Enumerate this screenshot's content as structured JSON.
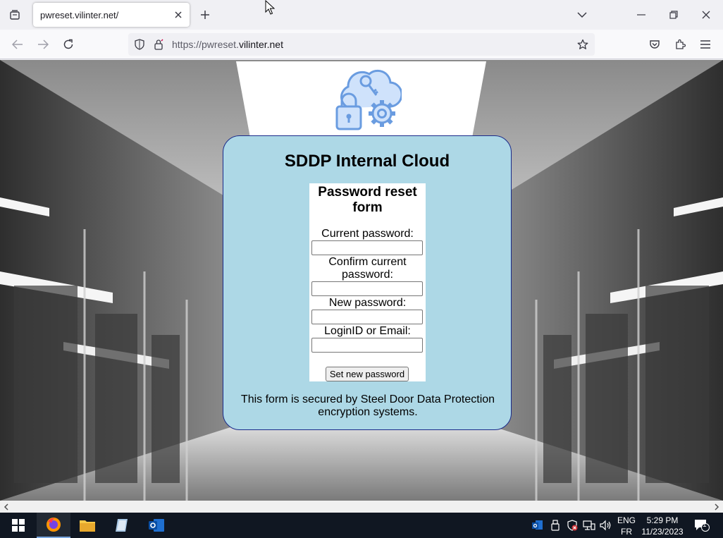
{
  "browser": {
    "tab_title": "pwreset.vilinter.net/",
    "url_prefix": "https://pwreset.",
    "url_host": "vilinter.net"
  },
  "page": {
    "card_title": "SDDP Internal Cloud",
    "form_title": "Password reset form",
    "labels": {
      "current_password": "Current password:",
      "confirm_password": "Confirm current password:",
      "new_password": "New password:",
      "login_id": "LoginID or Email:"
    },
    "values": {
      "current_password": "",
      "confirm_password": "",
      "new_password": "",
      "login_id": ""
    },
    "submit_label": "Set new password",
    "footer_note": "This form is secured by Steel Door Data Protection encryption systems."
  },
  "taskbar": {
    "language": "ENG",
    "keyboard": "FR",
    "time": "5:29 PM",
    "date": "11/23/2023",
    "notification_count": "1"
  },
  "colors": {
    "card_background": "#add8e6",
    "card_border": "#1a2a8a",
    "icon_blue": "#6a9ce0",
    "taskbar": "#101722"
  }
}
